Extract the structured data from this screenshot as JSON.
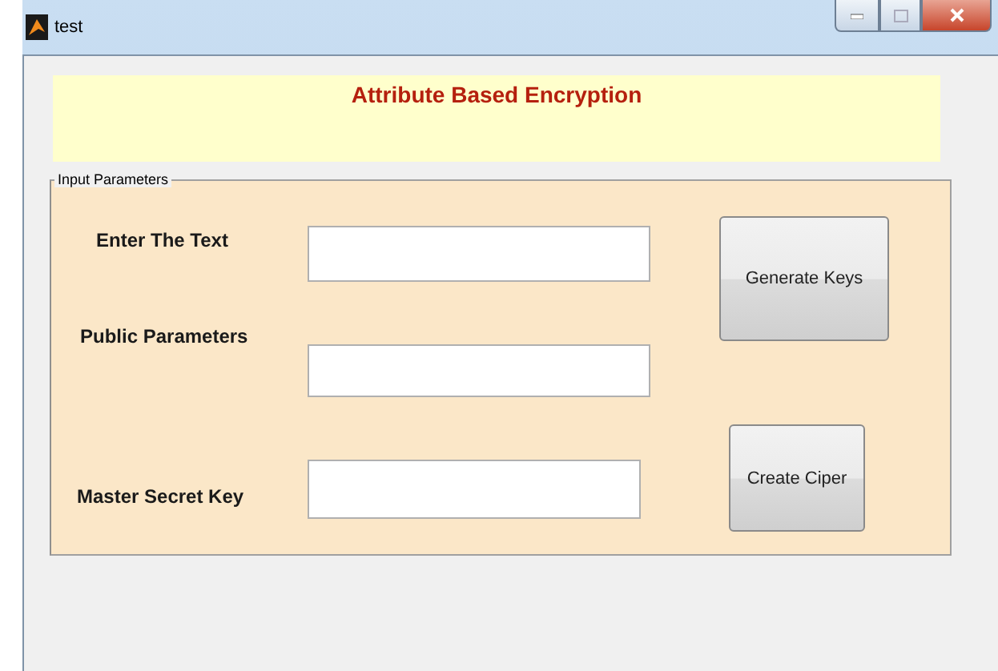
{
  "window": {
    "title": "test"
  },
  "banner": {
    "title": "Attribute Based Encryption"
  },
  "panel": {
    "title": "Input Parameters",
    "fields": [
      {
        "label": "Enter The Text"
      },
      {
        "label": "Public Parameters"
      },
      {
        "label": "Master Secret Key"
      }
    ],
    "buttons": [
      "Generate Keys",
      "Create Ciper"
    ]
  }
}
